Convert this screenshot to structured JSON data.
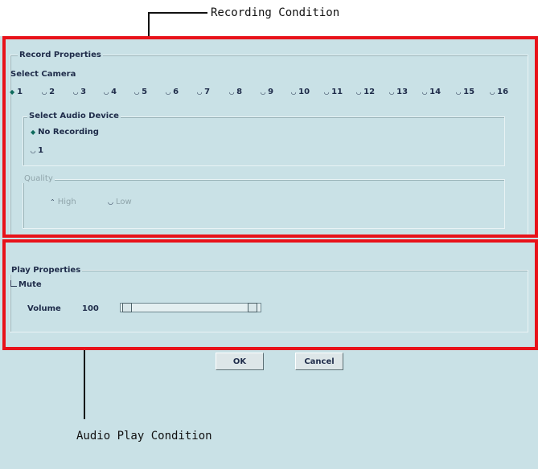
{
  "annotations": {
    "recording_condition": "Recording Condition",
    "audio_play_condition": "Audio Play Condition"
  },
  "record_properties": {
    "legend": "Record Properties",
    "select_camera_label": "Select Camera",
    "cameras": [
      "1",
      "2",
      "3",
      "4",
      "5",
      "6",
      "7",
      "8",
      "9",
      "10",
      "11",
      "12",
      "13",
      "14",
      "15",
      "16"
    ],
    "selected_camera": "1",
    "audio_device": {
      "legend": "Select Audio Device",
      "options": [
        "No Recording",
        "1"
      ],
      "selected": "No Recording"
    },
    "quality": {
      "legend": "Quality",
      "options": [
        "High",
        "Low"
      ],
      "enabled": false
    }
  },
  "play_properties": {
    "legend": "Play Properties",
    "mute_label": "Mute",
    "mute_checked": false,
    "volume_label": "Volume",
    "volume_value": "100"
  },
  "buttons": {
    "ok": "OK",
    "cancel": "Cancel"
  },
  "colors": {
    "panel_bg": "#c9e1e6",
    "highlight_red": "#e8121a"
  }
}
